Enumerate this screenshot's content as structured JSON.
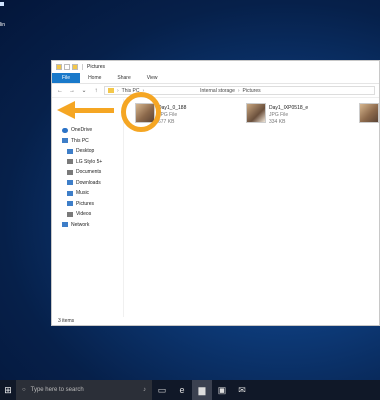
{
  "desktop": {
    "partial_label": "lin"
  },
  "window": {
    "title": "Pictures",
    "tabs": [
      "File",
      "Home",
      "Share",
      "View"
    ],
    "address": {
      "back": "←",
      "forward": "→",
      "down": "⌄",
      "up": "↑",
      "crumbs": [
        "This PC",
        "Internal storage",
        "Pictures"
      ]
    }
  },
  "nav_pane": {
    "items": [
      {
        "label": "OneDrive",
        "icon": "onedrive-icon",
        "level": 0
      },
      {
        "label": "This PC",
        "icon": "pc-icon",
        "level": 0
      },
      {
        "label": "Desktop",
        "icon": "desktop-folder-icon",
        "level": 1
      },
      {
        "label": "LG Stylo 5+",
        "icon": "phone-icon",
        "level": 1
      },
      {
        "label": "Documents",
        "icon": "documents-icon",
        "level": 1
      },
      {
        "label": "Downloads",
        "icon": "downloads-icon",
        "level": 1
      },
      {
        "label": "Music",
        "icon": "music-icon",
        "level": 1
      },
      {
        "label": "Pictures",
        "icon": "pictures-icon",
        "level": 1
      },
      {
        "label": "Videos",
        "icon": "videos-icon",
        "level": 1
      },
      {
        "label": "Network",
        "icon": "network-icon",
        "level": 0
      }
    ]
  },
  "files": [
    {
      "name": "Day1_0_188",
      "type": "JPG File",
      "size": "677 KB"
    },
    {
      "name": "Day1_IXP0518_e",
      "type": "JPG File",
      "size": "334 KB"
    }
  ],
  "status": {
    "items": "3 items"
  },
  "taskbar": {
    "search_placeholder": "Type here to search"
  },
  "colors": {
    "accent": "#1979ca",
    "annotation": "#f5a623",
    "taskbar": "#101828"
  }
}
